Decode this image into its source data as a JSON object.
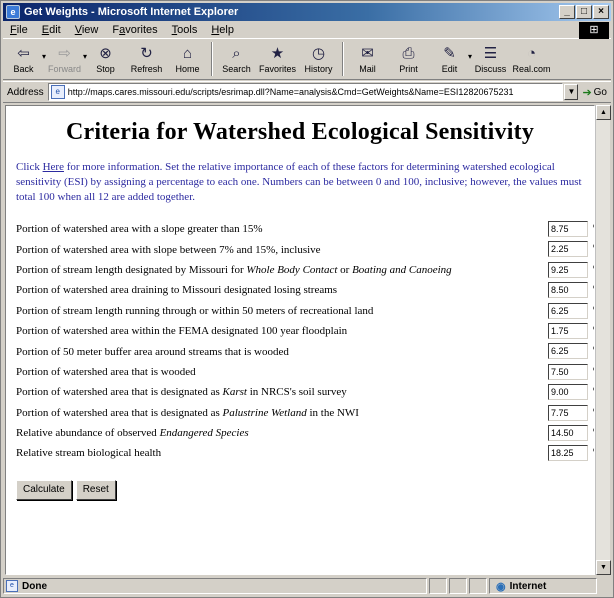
{
  "window": {
    "title": "Get Weights - Microsoft Internet Explorer",
    "controls": {
      "minimize": "_",
      "maximize": "□",
      "close": "×"
    }
  },
  "menu": {
    "items": [
      {
        "prefix": "",
        "key": "F",
        "rest": "ile"
      },
      {
        "prefix": "",
        "key": "E",
        "rest": "dit"
      },
      {
        "prefix": "",
        "key": "V",
        "rest": "iew"
      },
      {
        "prefix": "F",
        "key": "a",
        "rest": "vorites"
      },
      {
        "prefix": "",
        "key": "T",
        "rest": "ools"
      },
      {
        "prefix": "",
        "key": "H",
        "rest": "elp"
      }
    ]
  },
  "toolbar": {
    "back": {
      "label": "Back",
      "icon": "back-arrow-icon"
    },
    "forward": {
      "label": "Forward",
      "icon": "forward-arrow-icon"
    },
    "stop": {
      "label": "Stop",
      "icon": "stop-icon"
    },
    "refresh": {
      "label": "Refresh",
      "icon": "refresh-icon"
    },
    "home": {
      "label": "Home",
      "icon": "home-icon"
    },
    "search": {
      "label": "Search",
      "icon": "search-icon"
    },
    "favorites": {
      "label": "Favorites",
      "icon": "favorites-icon"
    },
    "history": {
      "label": "History",
      "icon": "history-icon"
    },
    "mail": {
      "label": "Mail",
      "icon": "mail-icon"
    },
    "print": {
      "label": "Print",
      "icon": "print-icon"
    },
    "edit": {
      "label": "Edit",
      "icon": "edit-icon"
    },
    "discuss": {
      "label": "Discuss",
      "icon": "discuss-icon"
    },
    "realcom": {
      "label": "Real.com",
      "icon": "realcom-icon"
    }
  },
  "address": {
    "label": "Address",
    "url": "http://maps.cares.missouri.edu/scripts/esrimap.dll?Name=analysis&Cmd=GetWeights&Name=ESI12820675231",
    "go": "Go"
  },
  "page": {
    "title": "Criteria for Watershed Ecological Sensitivity",
    "intro_prefix": "Click ",
    "intro_link": "Here",
    "intro_rest": " for more information.  Set the relative importance of each of these factors for determining watershed ecological sensitivity (ESI) by assigning a percentage to each one.  Numbers can be between 0 and 100, inclusive; however, the values must total 100 when all 12 are added together.",
    "criteria": [
      {
        "a": "Portion of watershed area with a slope greater than 15%",
        "i1": "",
        "b": "",
        "i2": "",
        "c": "",
        "value": "8.75"
      },
      {
        "a": "Portion of watershed area with slope between 7% and 15%, inclusive",
        "i1": "",
        "b": "",
        "i2": "",
        "c": "",
        "value": "2.25"
      },
      {
        "a": "Portion of stream length designated by Missouri for ",
        "i1": "Whole Body Contact",
        "b": " or ",
        "i2": "Boating and Canoeing",
        "c": "",
        "value": "9.25"
      },
      {
        "a": "Portion of watershed area draining to Missouri designated losing streams",
        "i1": "",
        "b": "",
        "i2": "",
        "c": "",
        "value": "8.50"
      },
      {
        "a": "Portion of stream length running through or within 50 meters of recreational land",
        "i1": "",
        "b": "",
        "i2": "",
        "c": "",
        "value": "6.25"
      },
      {
        "a": "Portion of watershed area within the FEMA designated 100 year floodplain",
        "i1": "",
        "b": "",
        "i2": "",
        "c": "",
        "value": "1.75"
      },
      {
        "a": "Portion of 50 meter buffer area around streams that is wooded",
        "i1": "",
        "b": "",
        "i2": "",
        "c": "",
        "value": "6.25"
      },
      {
        "a": "Portion of watershed area that is wooded",
        "i1": "",
        "b": "",
        "i2": "",
        "c": "",
        "value": "7.50"
      },
      {
        "a": "Portion of watershed area that is designated as ",
        "i1": "Karst",
        "b": " in NRCS's soil survey",
        "i2": "",
        "c": "",
        "value": "9.00"
      },
      {
        "a": "Portion of watershed area that is designated as ",
        "i1": "Palustrine Wetland",
        "b": " in the NWI",
        "i2": "",
        "c": "",
        "value": "7.75"
      },
      {
        "a": "Relative abundance of observed ",
        "i1": "Endangered Species",
        "b": "",
        "i2": "",
        "c": "",
        "value": "14.50"
      },
      {
        "a": "Relative stream biological health",
        "i1": "",
        "b": "",
        "i2": "",
        "c": "",
        "value": "18.25"
      }
    ],
    "percent_sign": "%",
    "buttons": {
      "calculate": "Calculate",
      "reset": "Reset"
    }
  },
  "status": {
    "text": "Done",
    "zone": "Internet"
  },
  "colors": {
    "intro_text": "#2c2aa0",
    "titlebar_start": "#0a246a",
    "titlebar_end": "#a6caf0"
  }
}
